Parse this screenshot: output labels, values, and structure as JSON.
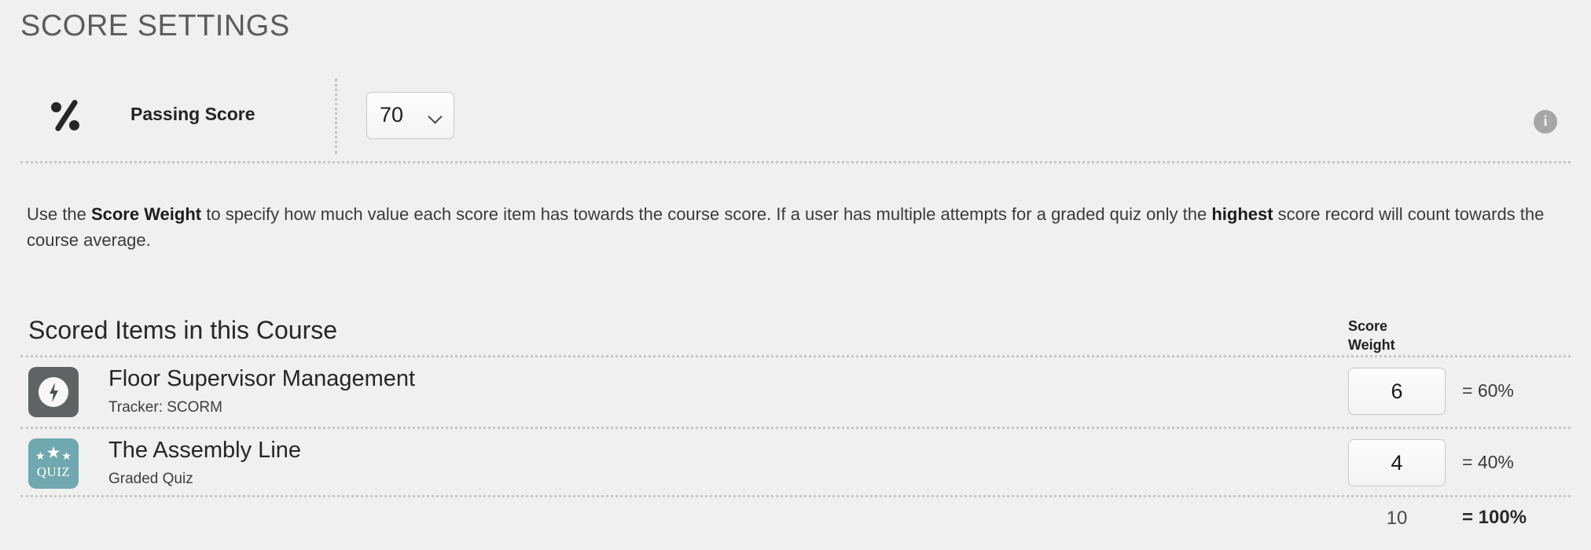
{
  "page_title": "SCORE SETTINGS",
  "passing_score": {
    "icon": "percent-icon",
    "label": "Passing Score",
    "selected_value": "70",
    "options": [
      "70"
    ],
    "chevron_icon": "chevron-down-icon",
    "info_icon": "info-icon",
    "info_glyph": "i"
  },
  "description": {
    "part1": "Use the ",
    "bold1": "Score Weight",
    "part2": " to specify how much value each score item has towards the course score. If a user has multiple attempts for a graded quiz only the ",
    "bold2": "highest",
    "part3": " score record will count towards the course average."
  },
  "scored_items": {
    "heading": "Scored Items in this Course",
    "weight_column_line1": "Score",
    "weight_column_line2": "Weight",
    "rows": [
      {
        "icon": "scorm-lightning-icon",
        "title": "Floor Supervisor Management",
        "subtitle": "Tracker: SCORM",
        "weight": "6",
        "percent": "= 60%"
      },
      {
        "icon": "quiz-stars-icon",
        "icon_label": "QUIZ",
        "title": "The Assembly Line",
        "subtitle": "Graded Quiz",
        "weight": "4",
        "percent": "= 40%"
      }
    ],
    "total_weight": "10",
    "total_percent": "= 100%"
  },
  "colors": {
    "background": "#f0f0f0",
    "title_gray": "#5c5c5c",
    "scorm_icon_bg": "#5f6364",
    "quiz_icon_bg": "#6fa8ae",
    "info_badge_bg": "#a6a6a6",
    "divider": "#c7c7c7"
  }
}
